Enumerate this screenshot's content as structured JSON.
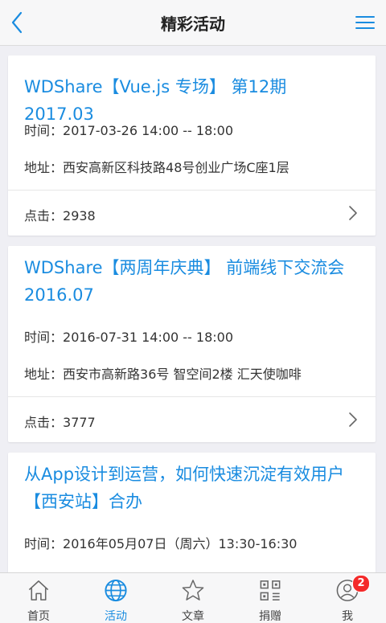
{
  "header": {
    "title": "精彩活动"
  },
  "events": [
    {
      "title": "WDShare【Vue.js 专场】 第12期 2017.03",
      "time_label": "时间：",
      "time": "2017-03-26 14:00 -- 18:00",
      "address_label": "地址：",
      "address": "西安高新区科技路48号创业广场C座1层",
      "clicks_label": "点击：",
      "clicks": "2938"
    },
    {
      "title_line1": "WDShare【两周年庆典】 前端线下交流会",
      "title_line2": "2016.07",
      "time_label": "时间：",
      "time": "2016-07-31 14:00 -- 18:00",
      "address_label": "地址：",
      "address": "西安市高新路36号 智空间2楼 汇天使咖啡",
      "clicks_label": "点击：",
      "clicks": "3777"
    },
    {
      "title_line1": "从App设计到运营，如何快速沉淀有效用户",
      "title_line2": "【西安站】合办",
      "time_label": "时间：",
      "time": "2016年05月07日（周六）13:30-16:30"
    }
  ],
  "tabs": [
    {
      "label": "首页",
      "icon": "home-icon"
    },
    {
      "label": "活动",
      "icon": "globe-icon"
    },
    {
      "label": "文章",
      "icon": "star-icon"
    },
    {
      "label": "捐赠",
      "icon": "qrcode-icon"
    },
    {
      "label": "我",
      "icon": "profile-icon",
      "badge": "2"
    }
  ],
  "colors": {
    "accent": "#1a8ce0",
    "badge": "#f42a2a"
  }
}
